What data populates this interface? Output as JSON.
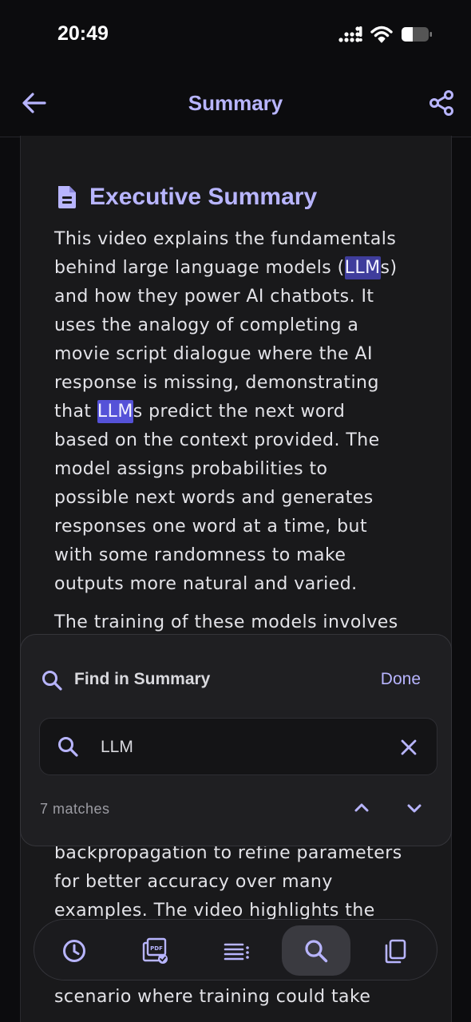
{
  "status_bar": {
    "time": "20:49"
  },
  "nav": {
    "title": "Summary"
  },
  "summary": {
    "heading": "Executive Summary",
    "p1": [
      [
        "This video explains the fundamentals"
      ],
      [
        "behind large language models (",
        "LLM",
        "s)"
      ],
      [
        "and how they power AI chatbots. It"
      ],
      [
        "uses the analogy of completing a"
      ],
      [
        "movie script dialogue where the AI"
      ],
      [
        "response is missing, demonstrating"
      ],
      [
        "that ",
        "LLM",
        "s predict the next word"
      ],
      [
        "based on the context provided. The"
      ],
      [
        "model assigns probabilities to"
      ],
      [
        "possible next words and generates"
      ],
      [
        "responses one word at a time, but"
      ],
      [
        "with some randomness to make"
      ],
      [
        "outputs more natural and varied."
      ]
    ],
    "p2_line1": "The training of these models involves",
    "p2_after": [
      "backpropagation to refine parameters",
      "for better accuracy over many",
      "examples. The video highlights the"
    ],
    "p2_bottom": "scenario where training could take"
  },
  "find": {
    "title": "Find in Summary",
    "done_label": "Done",
    "query": "LLM",
    "match_count": "7 matches",
    "current_match_index": 1
  },
  "toolbar": {
    "items": [
      {
        "icon": "history-icon",
        "active": false
      },
      {
        "icon": "pdf-export-icon",
        "active": false
      },
      {
        "icon": "list-icon",
        "active": false
      },
      {
        "icon": "search-icon",
        "active": true
      },
      {
        "icon": "copy-icon",
        "active": false
      }
    ]
  },
  "colors": {
    "accent": "#b8b5ff",
    "highlight": "#3f3d9c",
    "highlight_current": "#5552d8",
    "background": "#0c0c0e",
    "card": "#19191b"
  }
}
